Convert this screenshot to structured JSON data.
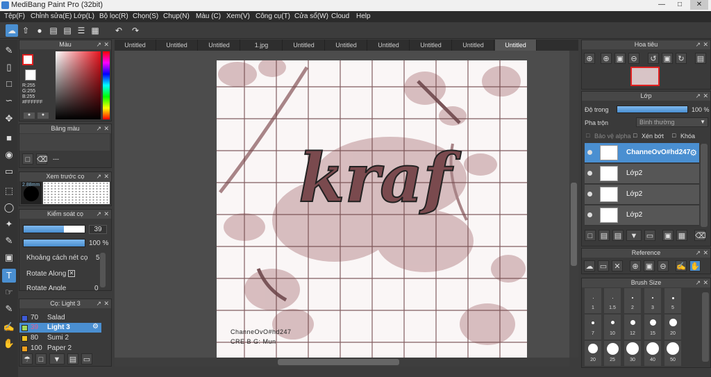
{
  "app": {
    "title": "MediBang Paint Pro (32bit)"
  },
  "menu": [
    "Tệp(F)",
    "Chỉnh sửa(E)",
    "Lớp(L)",
    "Bộ lọc(R)",
    "Chọn(S)",
    "Chụp(N)",
    "Màu (C)",
    "Xem(V)",
    "Công cụ(T)",
    "Cửa sổ(W)",
    "Cloud",
    "Help"
  ],
  "tabs": [
    "Untitled",
    "Untitled",
    "Untitled",
    "1.jpg",
    "Untitled",
    "Untitled",
    "Untitled",
    "Untitled",
    "Untitled",
    "Untitled"
  ],
  "color_panel": {
    "title": "Màu",
    "rgb_lines": [
      "R:255",
      "G:255",
      "B:255",
      "#FFFFFF"
    ]
  },
  "palette_panel": {
    "title": "Bảng màu",
    "empty": "---"
  },
  "brush_preview": {
    "title": "Xem trước cọ",
    "size": "2.88mm"
  },
  "brush_control": {
    "title": "Kiểm soát cọ",
    "size_value": "39",
    "opacity_value": "100 %",
    "spacing_label": "Khoảng cách nét cọ",
    "spacing_value": "5",
    "rotate_along": "Rotate Along",
    "rotate_angle": "Rotate Angle",
    "rotate_angle_value": "0"
  },
  "brush_list": {
    "title": "Cọ: Light 3",
    "items": [
      {
        "num": "70",
        "name": "Salad",
        "color": "#3e5bd6"
      },
      {
        "num": "39",
        "name": "Light 3",
        "color": "#a3d85b"
      },
      {
        "num": "80",
        "name": "Sumi 2",
        "color": "#f0c020"
      },
      {
        "num": "100",
        "name": "Paper 2",
        "color": "#f0a020"
      }
    ]
  },
  "canvas": {
    "main_text": "kraf",
    "credit1": "ChanneOvO#hd247",
    "credit2": "CRE B G: Mun",
    "line_color": "#8a3a44"
  },
  "navigator": {
    "title": "Hoa tiêu"
  },
  "layers": {
    "title": "Lớp",
    "opacity_label": "Độ trong",
    "opacity_value": "100 %",
    "blend_label": "Pha trộn",
    "blend_value": "Bình thường",
    "protect_alpha": "Bảo vệ alpha",
    "clipping": "Xén bớt",
    "lock": "Khóa",
    "items": [
      {
        "name": "ChanneOvO#hd247",
        "selected": true
      },
      {
        "name": "Lớp2",
        "selected": false
      },
      {
        "name": "Lớp2",
        "selected": false
      },
      {
        "name": "Lớp2",
        "selected": false
      }
    ]
  },
  "reference": {
    "title": "Reference"
  },
  "brush_size": {
    "title": "Brush Size",
    "rows": [
      [
        "1",
        "1.5",
        "2",
        "3",
        "5"
      ],
      [
        "7",
        "10",
        "12",
        "15",
        "20"
      ],
      [
        "20",
        "25",
        "30",
        "40",
        "50"
      ]
    ]
  },
  "accent": "#4a8fd1"
}
